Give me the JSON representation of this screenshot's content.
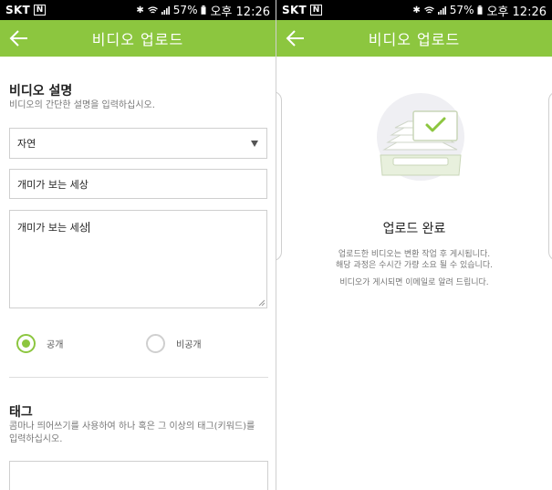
{
  "status": {
    "carrier": "SKT",
    "notification_badge": "N",
    "battery": "57%",
    "time": "오후 12:26"
  },
  "app_bar": {
    "title": "비디오 업로드",
    "back_icon": "arrow-left-icon"
  },
  "form": {
    "description_section": {
      "title": "비디오 설명",
      "helper": "비디오의 간단한 설명을 입력하십시오."
    },
    "category": {
      "selected": "자연"
    },
    "video_title": {
      "value": "개미가 보는 세상"
    },
    "description": {
      "value": "개미가  보는  세상"
    },
    "privacy": {
      "public_label": "공개",
      "private_label": "비공개",
      "selected": "public"
    },
    "tags_section": {
      "title": "태그",
      "helper_line1": "콤마나 띄어쓰기를 사용하여 하나 혹은 그 이상의 태그(키워드)를",
      "helper_line2": "입력하십시오."
    }
  },
  "upload_complete": {
    "title": "업로드 완료",
    "message_line1": "업로드한 비디오는 변환 작업 후 게시됩니다.",
    "message_line2": "해당 과정은 수시간 가량 소요 될 수 있습니다.",
    "message_line3": "비디오가 게시되면 이메일로 알려 드립니다."
  },
  "colors": {
    "accent": "#8cc63f",
    "status_bar": "#000000",
    "border": "#cfcfcf"
  }
}
